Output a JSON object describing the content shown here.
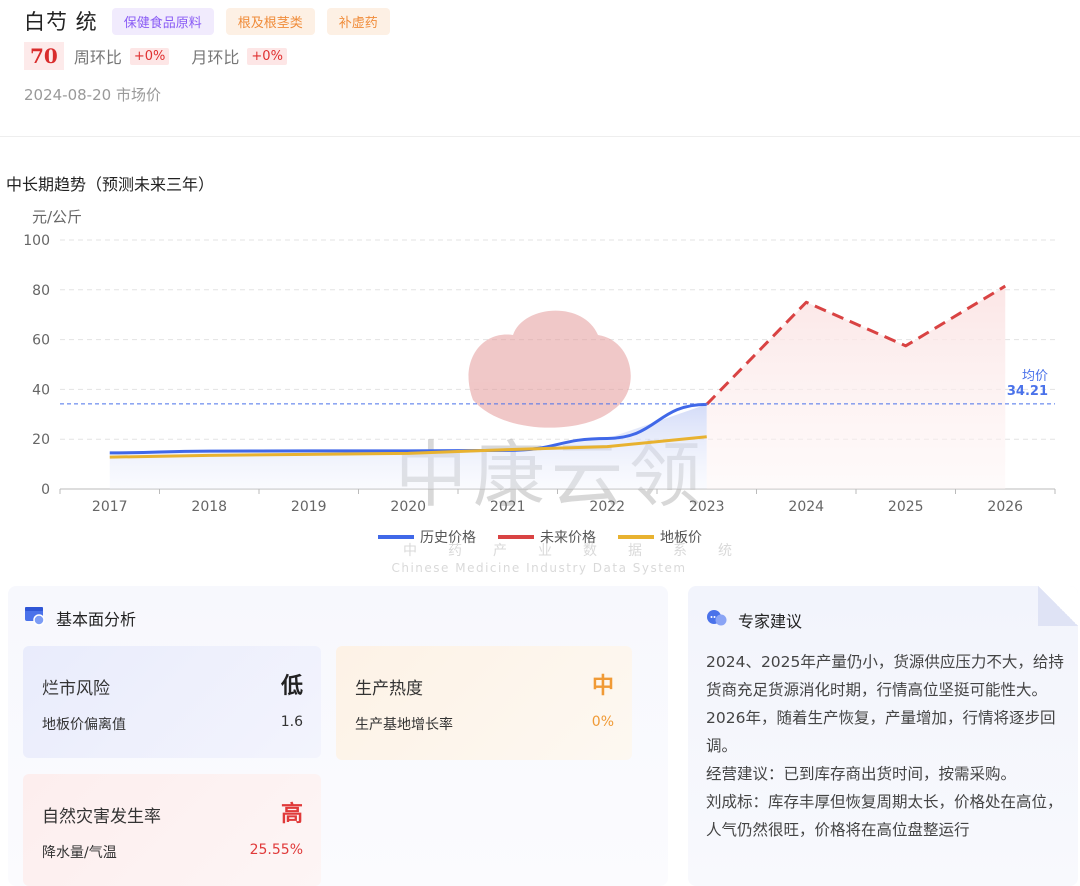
{
  "product": {
    "name": "白芍 统",
    "tags": [
      "保健食品原料",
      "根及根茎类",
      "补虚药"
    ]
  },
  "price": {
    "value": "70",
    "weekly_label": "周环比",
    "weekly_value": "+0%",
    "monthly_label": "月环比",
    "monthly_value": "+0%",
    "date_text": "2024-08-20 市场价"
  },
  "trend": {
    "section_title": "中长期趋势（预测未来三年）"
  },
  "chart_data": {
    "type": "line",
    "ylabel": "元/公斤",
    "ylim": [
      0,
      100
    ],
    "yticks": [
      0,
      20,
      40,
      60,
      80,
      100
    ],
    "categories": [
      "2017",
      "2018",
      "2019",
      "2020",
      "2021",
      "2022",
      "2023",
      "2024",
      "2025",
      "2026"
    ],
    "series": [
      {
        "name": "历史价格",
        "color": "#4068e8",
        "style": "solid",
        "values": [
          14.5,
          15.2,
          15.3,
          15.3,
          15.5,
          20.3,
          34.0,
          null,
          null,
          null
        ]
      },
      {
        "name": "未来价格",
        "color": "#d94343",
        "style": "dashed",
        "values": [
          null,
          null,
          null,
          null,
          null,
          null,
          34.0,
          75.0,
          57.5,
          81.5
        ]
      },
      {
        "name": "地板价",
        "color": "#e8b230",
        "style": "solid",
        "values": [
          12.8,
          13.5,
          13.9,
          14.3,
          15.8,
          17.0,
          21.0,
          null,
          null,
          null
        ]
      }
    ],
    "average": {
      "label": "均价",
      "value": 34.21
    },
    "legend_position": "bottom-center",
    "grid": true
  },
  "watermark": {
    "title": "中康云领",
    "chars": [
      "中",
      "药",
      "产",
      "业",
      "数",
      "据",
      "系",
      "统"
    ],
    "english": "Chinese Medicine Industry Data System"
  },
  "fundamentals": {
    "title": "基本面分析",
    "cards": [
      {
        "label": "烂市风险",
        "level": "低",
        "level_color": "#222222",
        "sub_label": "地板价偏离值",
        "sub_value": "1.6",
        "sub_color": "#333333"
      },
      {
        "label": "生产热度",
        "level": "中",
        "level_color": "#f09a36",
        "sub_label": "生产基地增长率",
        "sub_value": "0%",
        "sub_color": "#f09a36"
      },
      {
        "label": "自然灾害发生率",
        "level": "高",
        "level_color": "#e03a3a",
        "sub_label": "降水量/气温",
        "sub_value": "25.55%",
        "sub_color": "#e03a3a"
      }
    ]
  },
  "expert": {
    "title": "专家建议",
    "paragraphs": [
      "2024、2025年产量仍小，货源供应压力不大，给持货商充足货源消化时期，行情高位坚挺可能性大。2026年，随着生产恢复，产量增加，行情将逐步回调。",
      "经营建议：已到库存商出货时间，按需采购。",
      "刘成标：库存丰厚但恢复周期太长，价格处在高位，人气仍然很旺，价格将在高位盘整运行"
    ]
  }
}
